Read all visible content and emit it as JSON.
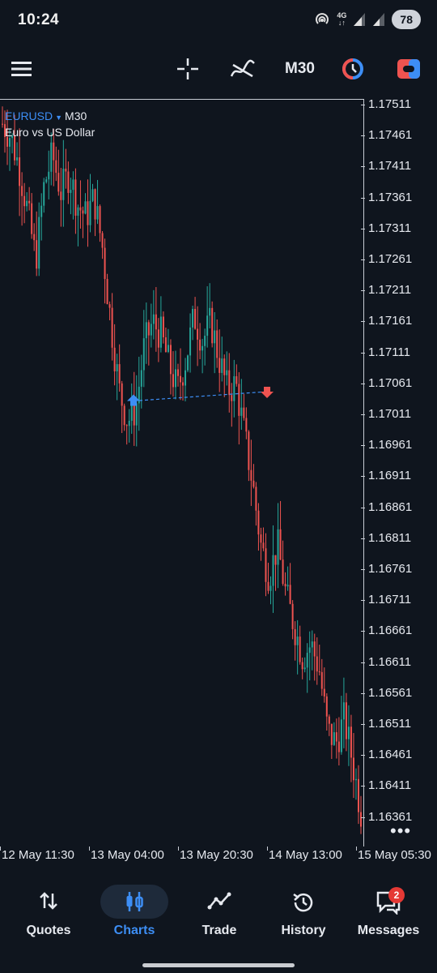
{
  "status_bar": {
    "time": "10:24",
    "network": "4G",
    "battery": "78"
  },
  "toolbar": {
    "timeframe": "M30"
  },
  "chart": {
    "symbol": "EURUSD",
    "timeframe": "M30",
    "description": "Euro vs US Dollar",
    "more": "•••"
  },
  "chart_data": {
    "type": "candlestick",
    "symbol": "EURUSD",
    "timeframe": "M30",
    "ylim": [
      1.1634,
      1.1753
    ],
    "yticks": [
      "1.17511",
      "1.17461",
      "1.17411",
      "1.17361",
      "1.17311",
      "1.17261",
      "1.17211",
      "1.17161",
      "1.17111",
      "1.17061",
      "1.17011",
      "1.16961",
      "1.16911",
      "1.16861",
      "1.16811",
      "1.16761",
      "1.16711",
      "1.16661",
      "1.16611",
      "1.16561",
      "1.16511",
      "1.16461",
      "1.16411",
      "1.16361"
    ],
    "xticks": [
      "12 May 11:30",
      "13 May 04:00",
      "13 May 20:30",
      "14 May 13:00",
      "15 May 05:30"
    ],
    "colors": {
      "up": "#26a69a",
      "down": "#ef5350",
      "buy_marker": "#3d8ef5",
      "sell_marker": "#ef5350",
      "trade_line": "#3d8ef5"
    },
    "path": [
      1.1748,
      1.1746,
      1.1741,
      1.1734,
      1.1726,
      1.1738,
      1.1743,
      1.1737,
      1.174,
      1.1735,
      1.1733,
      1.1736,
      1.1728,
      1.1716,
      1.1705,
      1.17,
      1.1702,
      1.1712,
      1.1716,
      1.1714,
      1.1709,
      1.1705,
      1.171,
      1.1717,
      1.1713,
      1.1716,
      1.171,
      1.1705,
      1.1706,
      1.1698,
      1.169,
      1.168,
      1.1675,
      1.168,
      1.1672,
      1.1667,
      1.1662,
      1.1664,
      1.166,
      1.165,
      1.1648,
      1.1652,
      1.1645,
      1.1637
    ],
    "trades": [
      {
        "type": "buy",
        "price": 1.1703
      },
      {
        "type": "sell",
        "price": 1.17045
      }
    ]
  },
  "nav": {
    "quotes": "Quotes",
    "charts": "Charts",
    "trade": "Trade",
    "history": "History",
    "messages": "Messages",
    "messages_badge": "2"
  }
}
